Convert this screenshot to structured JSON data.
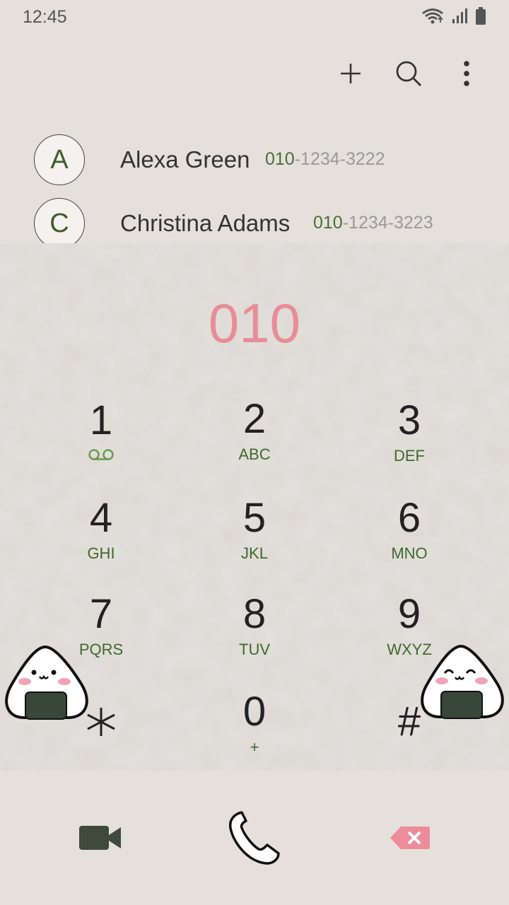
{
  "status": {
    "time": "12:45"
  },
  "toolbar": {
    "icons": [
      "add-icon",
      "search-icon",
      "more-options-icon"
    ]
  },
  "contacts": [
    {
      "initial": "A",
      "name": "Alexa Green",
      "match": "010",
      "rest": "-1234-3222"
    },
    {
      "initial": "C",
      "name": "Christina Adams",
      "match": "010",
      "rest": "-1234-3223"
    }
  ],
  "dialer": {
    "number": "010",
    "keys": [
      {
        "digit": "1",
        "letters": ""
      },
      {
        "digit": "2",
        "letters": "ABC"
      },
      {
        "digit": "3",
        "letters": "DEF"
      },
      {
        "digit": "4",
        "letters": "GHI"
      },
      {
        "digit": "5",
        "letters": "JKL"
      },
      {
        "digit": "6",
        "letters": "MNO"
      },
      {
        "digit": "7",
        "letters": "PQRS"
      },
      {
        "digit": "8",
        "letters": "TUV"
      },
      {
        "digit": "9",
        "letters": "WXYZ"
      },
      {
        "digit": "*",
        "letters": ""
      },
      {
        "digit": "0",
        "letters": "+"
      },
      {
        "digit": "#",
        "letters": ""
      }
    ]
  },
  "actions": [
    "video-call-icon",
    "call-icon",
    "backspace-icon"
  ],
  "colors": {
    "dialed": "#e88d98",
    "accent_green": "#3e6a2b",
    "background": "#e6e0dd"
  }
}
